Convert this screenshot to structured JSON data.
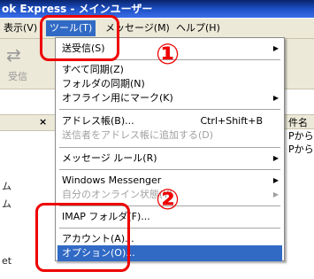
{
  "window": {
    "title": "ok Express - メインユーザー"
  },
  "menubar": {
    "items": [
      {
        "label": "表示(V)"
      },
      {
        "label": "ツール(T)"
      },
      {
        "label": "メッセージ(M)"
      },
      {
        "label": "ヘルプ(H)"
      }
    ]
  },
  "toolbar": {
    "receive_label": "受信"
  },
  "left_pane": {
    "close_label": "×",
    "folders": [
      "ム",
      "ム",
      "et"
    ]
  },
  "right_pane": {
    "header": "件名",
    "rows": [
      "Pから同",
      "Pから同"
    ]
  },
  "tools_menu": {
    "items": [
      {
        "label": "送受信(S)",
        "submenu": true,
        "disabled": false
      },
      {
        "label": "すべて同期(Z)",
        "disabled": false
      },
      {
        "label": "フォルダの同期(N)",
        "disabled": false
      },
      {
        "label": "オフライン用にマーク(K)",
        "submenu": true,
        "disabled": false
      },
      {
        "label": "アドレス帳(B)...",
        "shortcut": "Ctrl+Shift+B",
        "disabled": false
      },
      {
        "label": "送信者をアドレス帳に追加する(D)",
        "disabled": true
      },
      {
        "label": "メッセージ ルール(R)",
        "submenu": true,
        "disabled": false
      },
      {
        "label": "Windows Messenger",
        "submenu": true,
        "disabled": false
      },
      {
        "label": "自分のオンライン状態(Y)",
        "submenu": true,
        "disabled": true
      },
      {
        "label": "IMAP フォルダ(F)...",
        "disabled": false
      },
      {
        "label": "アカウント(A)...",
        "disabled": false
      },
      {
        "label": "オプション(O)...",
        "disabled": false,
        "highlighted": true
      }
    ]
  },
  "annotations": {
    "marker1": "①",
    "marker2": "②",
    "color": "#ee0000"
  }
}
